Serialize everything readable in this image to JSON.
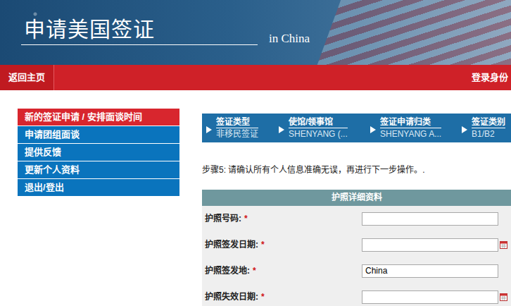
{
  "header": {
    "title": "申请美国签证",
    "subtitle": "in China"
  },
  "topbar": {
    "home": "返回主页",
    "login": "登录身份"
  },
  "sidebar": {
    "items": [
      {
        "label": "新的签证申请 / 安排面谈时间",
        "selected": true
      },
      {
        "label": "申请团组面谈",
        "selected": false
      },
      {
        "label": "提供反馈",
        "selected": false
      },
      {
        "label": "更新个人资料",
        "selected": false
      },
      {
        "label": "退出/登出",
        "selected": false
      }
    ]
  },
  "steps": [
    {
      "title": "签证类型",
      "value": "非移民签证"
    },
    {
      "title": "使馆/领事馆",
      "value": "SHENYANG (..."
    },
    {
      "title": "签证申请归类",
      "value": "SHENYANG A..."
    },
    {
      "title": "签证类别",
      "value": "B1/B2"
    }
  ],
  "instruction": "步骤5: 请确认所有个人信息准确无误，再进行下一步操作。.",
  "form": {
    "title": "护照详细资料",
    "fields": [
      {
        "label": "护照号码:",
        "required": "*",
        "value": "",
        "kind": "text"
      },
      {
        "label": "护照签发日期:",
        "required": "*",
        "value": "",
        "kind": "date"
      },
      {
        "label": "护照签发地:",
        "required": "*",
        "value": "China",
        "kind": "text"
      },
      {
        "label": "护照失效日期:",
        "required": "*",
        "value": "",
        "kind": "date"
      }
    ]
  }
}
